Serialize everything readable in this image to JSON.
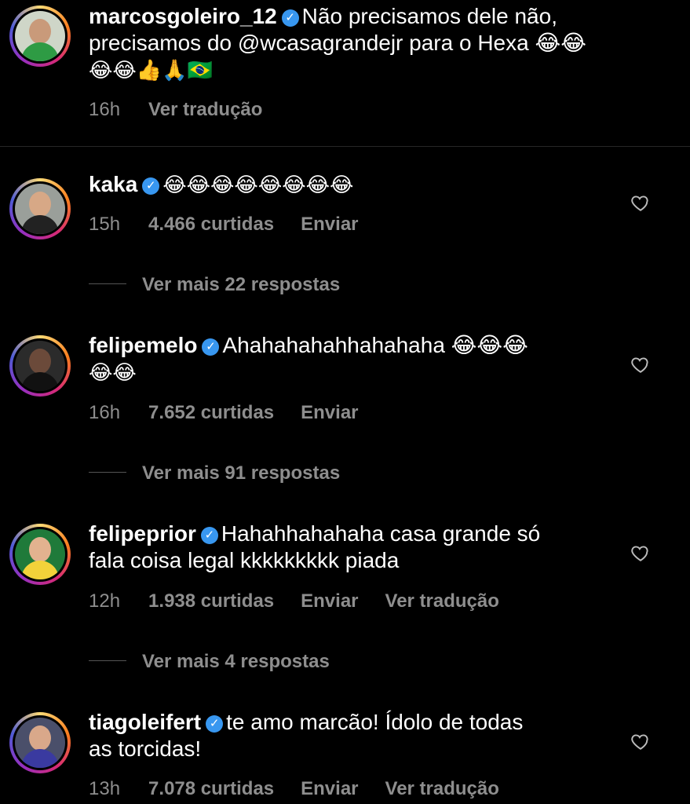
{
  "caption": {
    "username": "marcosgoleiro_12",
    "line1": "Não precisamos dele não,",
    "line2": "precisamos do @wcasagrandejr para o Hexa 😂😂",
    "line3": "😂😂👍🙏🇧🇷",
    "time": "16h",
    "translate": "Ver tradução"
  },
  "comments": [
    {
      "username": "kaka",
      "line1": "😂😂😂😂😂😂😂😂",
      "line2": "",
      "time": "15h",
      "likes": "4.466 curtidas",
      "reply": "Enviar",
      "translate": "",
      "more_replies": "Ver mais 22 respostas"
    },
    {
      "username": "felipemelo",
      "line1": "Ahahahahahhahahaha 😂😂😂",
      "line2": "😂😂",
      "time": "16h",
      "likes": "7.652 curtidas",
      "reply": "Enviar",
      "translate": "",
      "more_replies": "Ver mais 91 respostas"
    },
    {
      "username": "felipeprior",
      "line1": "Hahahhahahaha  casa grande só",
      "line2": "fala coisa legal kkkkkkkkk piada",
      "time": "12h",
      "likes": "1.938 curtidas",
      "reply": "Enviar",
      "translate": "Ver tradução",
      "more_replies": "Ver mais 4 respostas"
    },
    {
      "username": "tiagoleifert",
      "line1": "te amo marcão! Ídolo de todas",
      "line2": "as torcidas!",
      "time": "13h",
      "likes": "7.078 curtidas",
      "reply": "Enviar",
      "translate": "Ver tradução",
      "more_replies": ""
    }
  ],
  "icons": {
    "verified": "verified-badge-icon",
    "like": "heart-outline-icon"
  },
  "colors": {
    "background": "#000000",
    "muted": "#8e8e8e",
    "verified": "#3897f0"
  }
}
